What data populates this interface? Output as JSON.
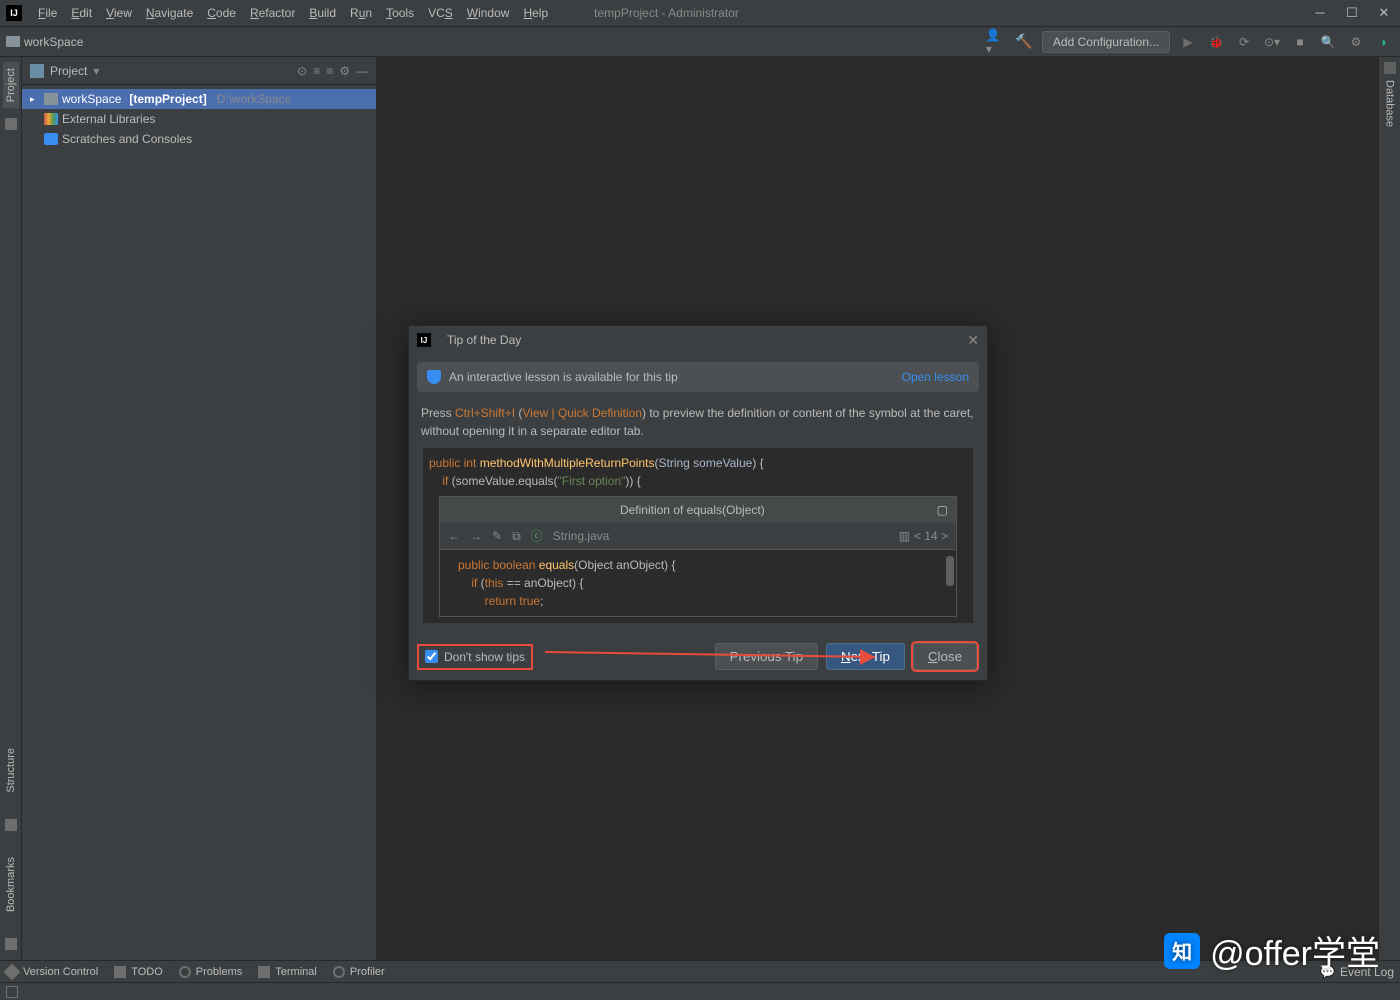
{
  "titlebar": {
    "title": "tempProject - Administrator"
  },
  "menu": [
    "File",
    "Edit",
    "View",
    "Navigate",
    "Code",
    "Refactor",
    "Build",
    "Run",
    "Tools",
    "VCS",
    "Window",
    "Help"
  ],
  "toolbar": {
    "breadcrumb": "workSpace",
    "config": "Add Configuration..."
  },
  "sidebar": {
    "title": "Project",
    "items": [
      {
        "name": "workSpace",
        "tag": "[tempProject]",
        "path": "D:\\workSpace"
      },
      {
        "name": "External Libraries"
      },
      {
        "name": "Scratches and Consoles"
      }
    ]
  },
  "left_tabs": [
    "Project",
    "Structure",
    "Bookmarks"
  ],
  "right_tabs": [
    "Database"
  ],
  "dialog": {
    "title": "Tip of the Day",
    "lesson_text": "An interactive lesson is available for this tip",
    "open_lesson": "Open lesson",
    "tip_pre": "Press ",
    "tip_kbd": "Ctrl+Shift+I",
    "tip_menu": "View | Quick Definition",
    "tip_post": ") to preview the definition or content of the symbol at the caret, without opening it in a separate editor tab.",
    "def_title": "Definition of equals(Object)",
    "def_file": "String.java",
    "def_nav": "< 14 >",
    "dont_show": "Don't show tips",
    "prev": "Previous Tip",
    "next": "Next Tip",
    "close": "Close"
  },
  "bottom_tabs": [
    "Version Control",
    "TODO",
    "Problems",
    "Terminal",
    "Profiler"
  ],
  "event_log": "Event Log",
  "watermark": "@offer学堂"
}
